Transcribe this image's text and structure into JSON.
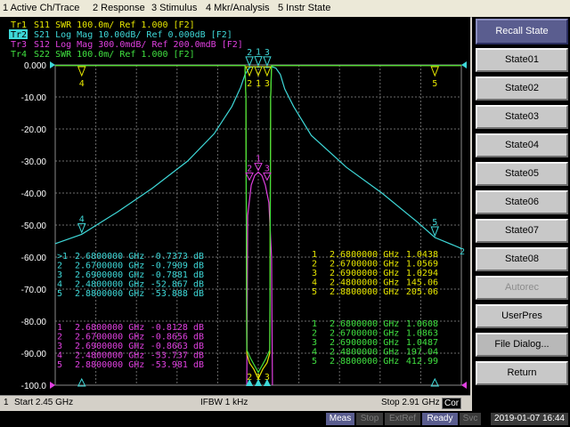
{
  "menu": {
    "items": [
      "1 Active Ch/Trace",
      "2 Response",
      "3 Stimulus",
      "4 Mkr/Analysis",
      "5 Instr State"
    ]
  },
  "traces": {
    "lines": [
      {
        "prefix": "Tr1",
        "text": "S11  SWR 100.0m/ Ref 1.000 [F2]",
        "color": "#e6e600"
      },
      {
        "prefix": "Tr2",
        "text": "S21  Log Mag 10.00dB/ Ref 0.000dB [F2]",
        "color": "#3ed8d8",
        "active": true
      },
      {
        "prefix": "Tr3",
        "text": "S12  Log Mag 300.0mdB/ Ref 200.0mdB [F2]",
        "color": "#e040e0"
      },
      {
        "prefix": "Tr4",
        "text": "S22  SWR 100.0m/ Ref 1.000 [F2]",
        "color": "#40e040"
      }
    ]
  },
  "chart_data": {
    "type": "line",
    "y_ticks": [
      "0.000",
      "-10.00",
      "-20.00",
      "-30.00",
      "-40.00",
      "-50.00",
      "-60.00",
      "-70.00",
      "-80.00",
      "-90.00",
      "-100.0"
    ],
    "ylim": [
      -100,
      0
    ],
    "xlim": [
      2.45,
      2.91
    ],
    "x_unit": "GHz",
    "grid": true,
    "series": [
      {
        "name": "S21",
        "color": "#3ed8d8",
        "x": [
          2.45,
          2.48,
          2.52,
          2.56,
          2.6,
          2.63,
          2.65,
          2.66,
          2.665,
          2.67,
          2.675,
          2.68,
          2.685,
          2.69,
          2.695,
          2.7,
          2.705,
          2.71,
          2.72,
          2.74,
          2.78,
          2.82,
          2.86,
          2.88,
          2.91
        ],
        "y": [
          -55.8,
          -52.9,
          -46,
          -38.5,
          -30,
          -21.5,
          -13,
          -7,
          -3,
          -0.8,
          -0.5,
          -0.7,
          -0.5,
          -0.8,
          -0.5,
          -1,
          -3,
          -7.5,
          -13,
          -22,
          -32,
          -40,
          -49,
          -53.9,
          -57.3
        ]
      },
      {
        "name": "S12",
        "color": "#e040e0",
        "x": [
          2.667,
          2.668,
          2.672,
          2.676,
          2.68,
          2.684,
          2.688,
          2.692,
          2.695,
          2.696
        ],
        "y": [
          -100,
          -47,
          -37.5,
          -34.5,
          -33.5,
          -34.5,
          -37.5,
          -43,
          -60,
          -100
        ]
      },
      {
        "name": "S11",
        "color": "#e6e600",
        "x": [
          2.45,
          2.665,
          2.666,
          2.667,
          2.67,
          2.675,
          2.68,
          2.685,
          2.69,
          2.693,
          2.694,
          2.695,
          2.91
        ],
        "y": [
          -0.2,
          -0.2,
          -10,
          -90,
          -93,
          -95,
          -98,
          -95,
          -93,
          -90,
          -10,
          -0.2,
          -0.2
        ]
      },
      {
        "name": "S22",
        "color": "#40e040",
        "x": [
          2.45,
          2.665,
          2.666,
          2.667,
          2.671,
          2.676,
          2.68,
          2.684,
          2.689,
          2.693,
          2.694,
          2.695,
          2.91
        ],
        "y": [
          -0.2,
          -0.2,
          -10,
          -89,
          -91.5,
          -94,
          -96,
          -94,
          -91.5,
          -89,
          -10,
          -0.2,
          -0.2
        ]
      }
    ],
    "markers_top": [
      {
        "label": "4",
        "x": 2.48
      },
      {
        "label": "2",
        "x": 2.67
      },
      {
        "label": "1",
        "x": 2.68
      },
      {
        "label": "3",
        "x": 2.69
      },
      {
        "label": "5",
        "x": 2.88
      }
    ],
    "markers_cyan": [
      {
        "label": "4",
        "x": 2.48,
        "y": -52.867
      },
      {
        "label": "2",
        "x": 2.67,
        "y": -0.7909
      },
      {
        "label": "1",
        "x": 2.68,
        "y": -0.7373
      },
      {
        "label": "3",
        "x": 2.69,
        "y": -0.7881
      },
      {
        "label": "5",
        "x": 2.88,
        "y": -53.888
      }
    ],
    "markers_magenta": [
      {
        "label": "2",
        "x": 2.67,
        "y": -36.5
      },
      {
        "label": "1",
        "x": 2.68,
        "y": -33.5
      },
      {
        "label": "3",
        "x": 2.69,
        "y": -36.5
      }
    ],
    "markers_bottom": [
      {
        "label": "2",
        "x": 2.67
      },
      {
        "label": "1",
        "x": 2.68
      },
      {
        "label": "3",
        "x": 2.69
      }
    ],
    "right_edge_label": "2",
    "marker_tables": [
      {
        "color": "#3ed8d8",
        "rows": [
          {
            "mk": ">1",
            "freq": "2.6800000 GHz",
            "val": "-0.7373 dB"
          },
          {
            "mk": "2",
            "freq": "2.6700000 GHz",
            "val": "-0.7909 dB"
          },
          {
            "mk": "3",
            "freq": "2.6900000 GHz",
            "val": "-0.7881 dB"
          },
          {
            "mk": "4",
            "freq": "2.4800000 GHz",
            "val": "-52.867 dB"
          },
          {
            "mk": "5",
            "freq": "2.8800000 GHz",
            "val": "-53.888 dB"
          }
        ]
      },
      {
        "color": "#e040e0",
        "rows": [
          {
            "mk": "1",
            "freq": "2.6800000 GHz",
            "val": "-0.8128 dB"
          },
          {
            "mk": "2",
            "freq": "2.6700000 GHz",
            "val": "-0.8656 dB"
          },
          {
            "mk": "3",
            "freq": "2.6900000 GHz",
            "val": "-0.8663 dB"
          },
          {
            "mk": "4",
            "freq": "2.4800000 GHz",
            "val": "-53.737 dB"
          },
          {
            "mk": "5",
            "freq": "2.8800000 GHz",
            "val": "-53.981 dB"
          }
        ]
      },
      {
        "color": "#e6e600",
        "rows": [
          {
            "mk": "1",
            "freq": "2.6800000 GHz",
            "val": "1.0438"
          },
          {
            "mk": "2",
            "freq": "2.6700000 GHz",
            "val": "1.0569"
          },
          {
            "mk": "3",
            "freq": "2.6900000 GHz",
            "val": "1.0294"
          },
          {
            "mk": "4",
            "freq": "2.4800000 GHz",
            "val": "145.06"
          },
          {
            "mk": "5",
            "freq": "2.8800000 GHz",
            "val": "205.06"
          }
        ]
      },
      {
        "color": "#40e040",
        "rows": [
          {
            "mk": "1",
            "freq": "2.6800000 GHz",
            "val": "1.0608"
          },
          {
            "mk": "2",
            "freq": "2.6700000 GHz",
            "val": "1.0863"
          },
          {
            "mk": "3",
            "freq": "2.6900000 GHz",
            "val": "1.0487"
          },
          {
            "mk": "4",
            "freq": "2.4800000 GHz",
            "val": "197.04"
          },
          {
            "mk": "5",
            "freq": "2.8800000 GHz",
            "val": "412.99"
          }
        ]
      }
    ]
  },
  "bottom": {
    "channel": "1",
    "start": "Start 2.45 GHz",
    "ifbw": "IFBW 1 kHz",
    "stop": "Stop 2.91 GHz",
    "cor": "Cor"
  },
  "softkeys": {
    "title": "Recall State",
    "items": [
      "State01",
      "State02",
      "State03",
      "State04",
      "State05",
      "State06",
      "State07",
      "State08"
    ],
    "autorec": "Autorec",
    "userpres": "UserPres",
    "file_dialog": "File Dialog...",
    "return": "Return"
  },
  "status": {
    "meas": "Meas",
    "stop": "Stop",
    "extref": "ExtRef",
    "ready": "Ready",
    "svc": "Svc",
    "datetime": "2019-01-07 16:44"
  },
  "colors": {
    "s21": "#3ed8d8",
    "s12": "#e040e0",
    "s11": "#e6e600",
    "s22": "#40e040",
    "grid": "#6b6b6b",
    "axis_label": "#ffffff"
  }
}
